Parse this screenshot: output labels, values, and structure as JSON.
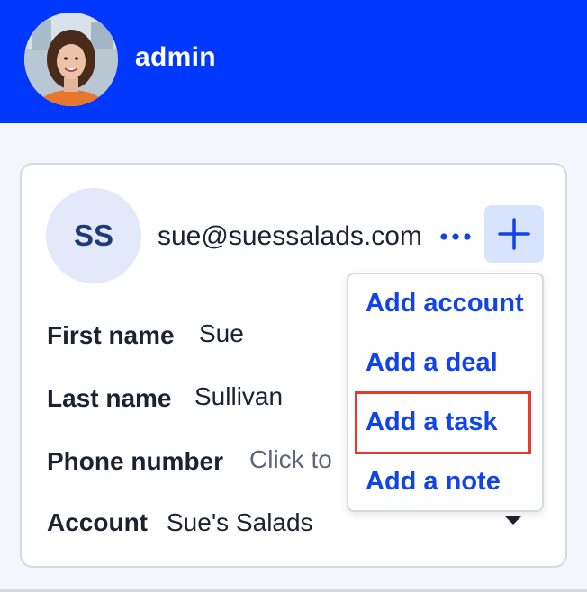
{
  "header": {
    "user_name": "admin",
    "background_color": "#0038ff",
    "avatar_icon": "user-avatar-photo"
  },
  "contact": {
    "initials": "SS",
    "email": "sue@suessalads.com",
    "more_icon": "more-horizontal-icon",
    "add_icon": "plus-icon",
    "fields": [
      {
        "label": "First name",
        "value": "Sue"
      },
      {
        "label": "Last name",
        "value": "Sullivan"
      },
      {
        "label": "Phone number",
        "placeholder": "Click to"
      },
      {
        "label": "Account",
        "value": "Sue's Salads",
        "dropdown_icon": "caret-down-icon"
      }
    ]
  },
  "add_menu": {
    "items": [
      {
        "label": "Add account"
      },
      {
        "label": "Add a deal"
      },
      {
        "label": "Add a task",
        "highlighted": true
      },
      {
        "label": "Add a note"
      }
    ],
    "link_color": "#1144e8",
    "highlight_color": "#e8392b"
  }
}
